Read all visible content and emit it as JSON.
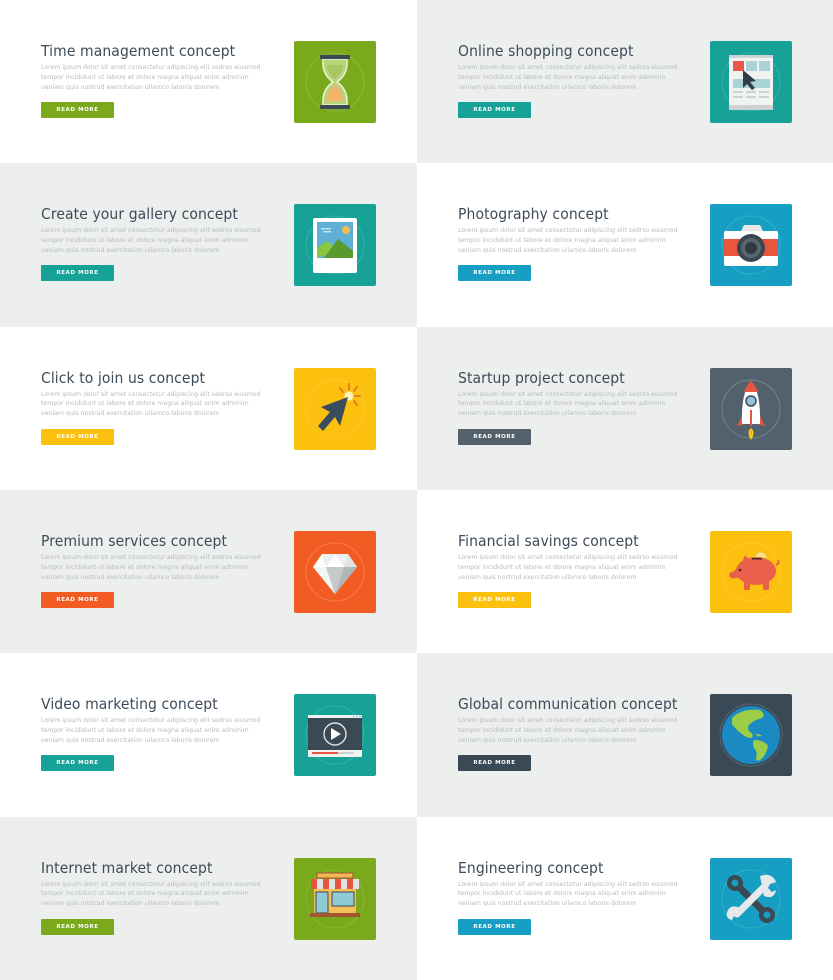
{
  "body_text": "Lorem ipsum dolor sit amet consectetur adipiscing elit sedrso eiusmod tempor incididunt ut labore et dolore magna aliquat enim adminim veniam quis nostrud exercitation ullamco laboris dolorem",
  "button_label": "READ MORE",
  "cards": [
    {
      "title": "Time management concept",
      "icon": "hourglass-icon",
      "accent": "#7aaa1c",
      "button_color": "#7aaa1c"
    },
    {
      "title": "Online shopping concept",
      "icon": "online-shop-cursor-icon",
      "accent": "#16a296",
      "button_color": "#16a296"
    },
    {
      "title": "Create your gallery concept",
      "icon": "photo-gallery-icon",
      "accent": "#16a296",
      "button_color": "#16a296"
    },
    {
      "title": "Photography concept",
      "icon": "camera-icon",
      "accent": "#169fc3",
      "button_color": "#169fc3"
    },
    {
      "title": "Click to join us concept",
      "icon": "click-cursor-icon",
      "accent": "#fcc10e",
      "button_color": "#fcc10e"
    },
    {
      "title": "Startup project concept",
      "icon": "rocket-icon",
      "accent": "#53616c",
      "button_color": "#53616c"
    },
    {
      "title": "Premium services concept",
      "icon": "diamond-icon",
      "accent": "#f25c23",
      "button_color": "#f25c23"
    },
    {
      "title": "Financial savings concept",
      "icon": "piggy-bank-icon",
      "accent": "#fcc10e",
      "button_color": "#fcc10e"
    },
    {
      "title": "Video marketing concept",
      "icon": "video-player-icon",
      "accent": "#16a296",
      "button_color": "#16a296"
    },
    {
      "title": "Global communication concept",
      "icon": "globe-icon",
      "accent": "#3a4956",
      "button_color": "#3a4956"
    },
    {
      "title": "Internet market concept",
      "icon": "storefront-icon",
      "accent": "#7aaa1c",
      "button_color": "#7aaa1c"
    },
    {
      "title": "Engineering concept",
      "icon": "wrench-icon",
      "accent": "#169fc3",
      "button_color": "#169fc3"
    }
  ]
}
